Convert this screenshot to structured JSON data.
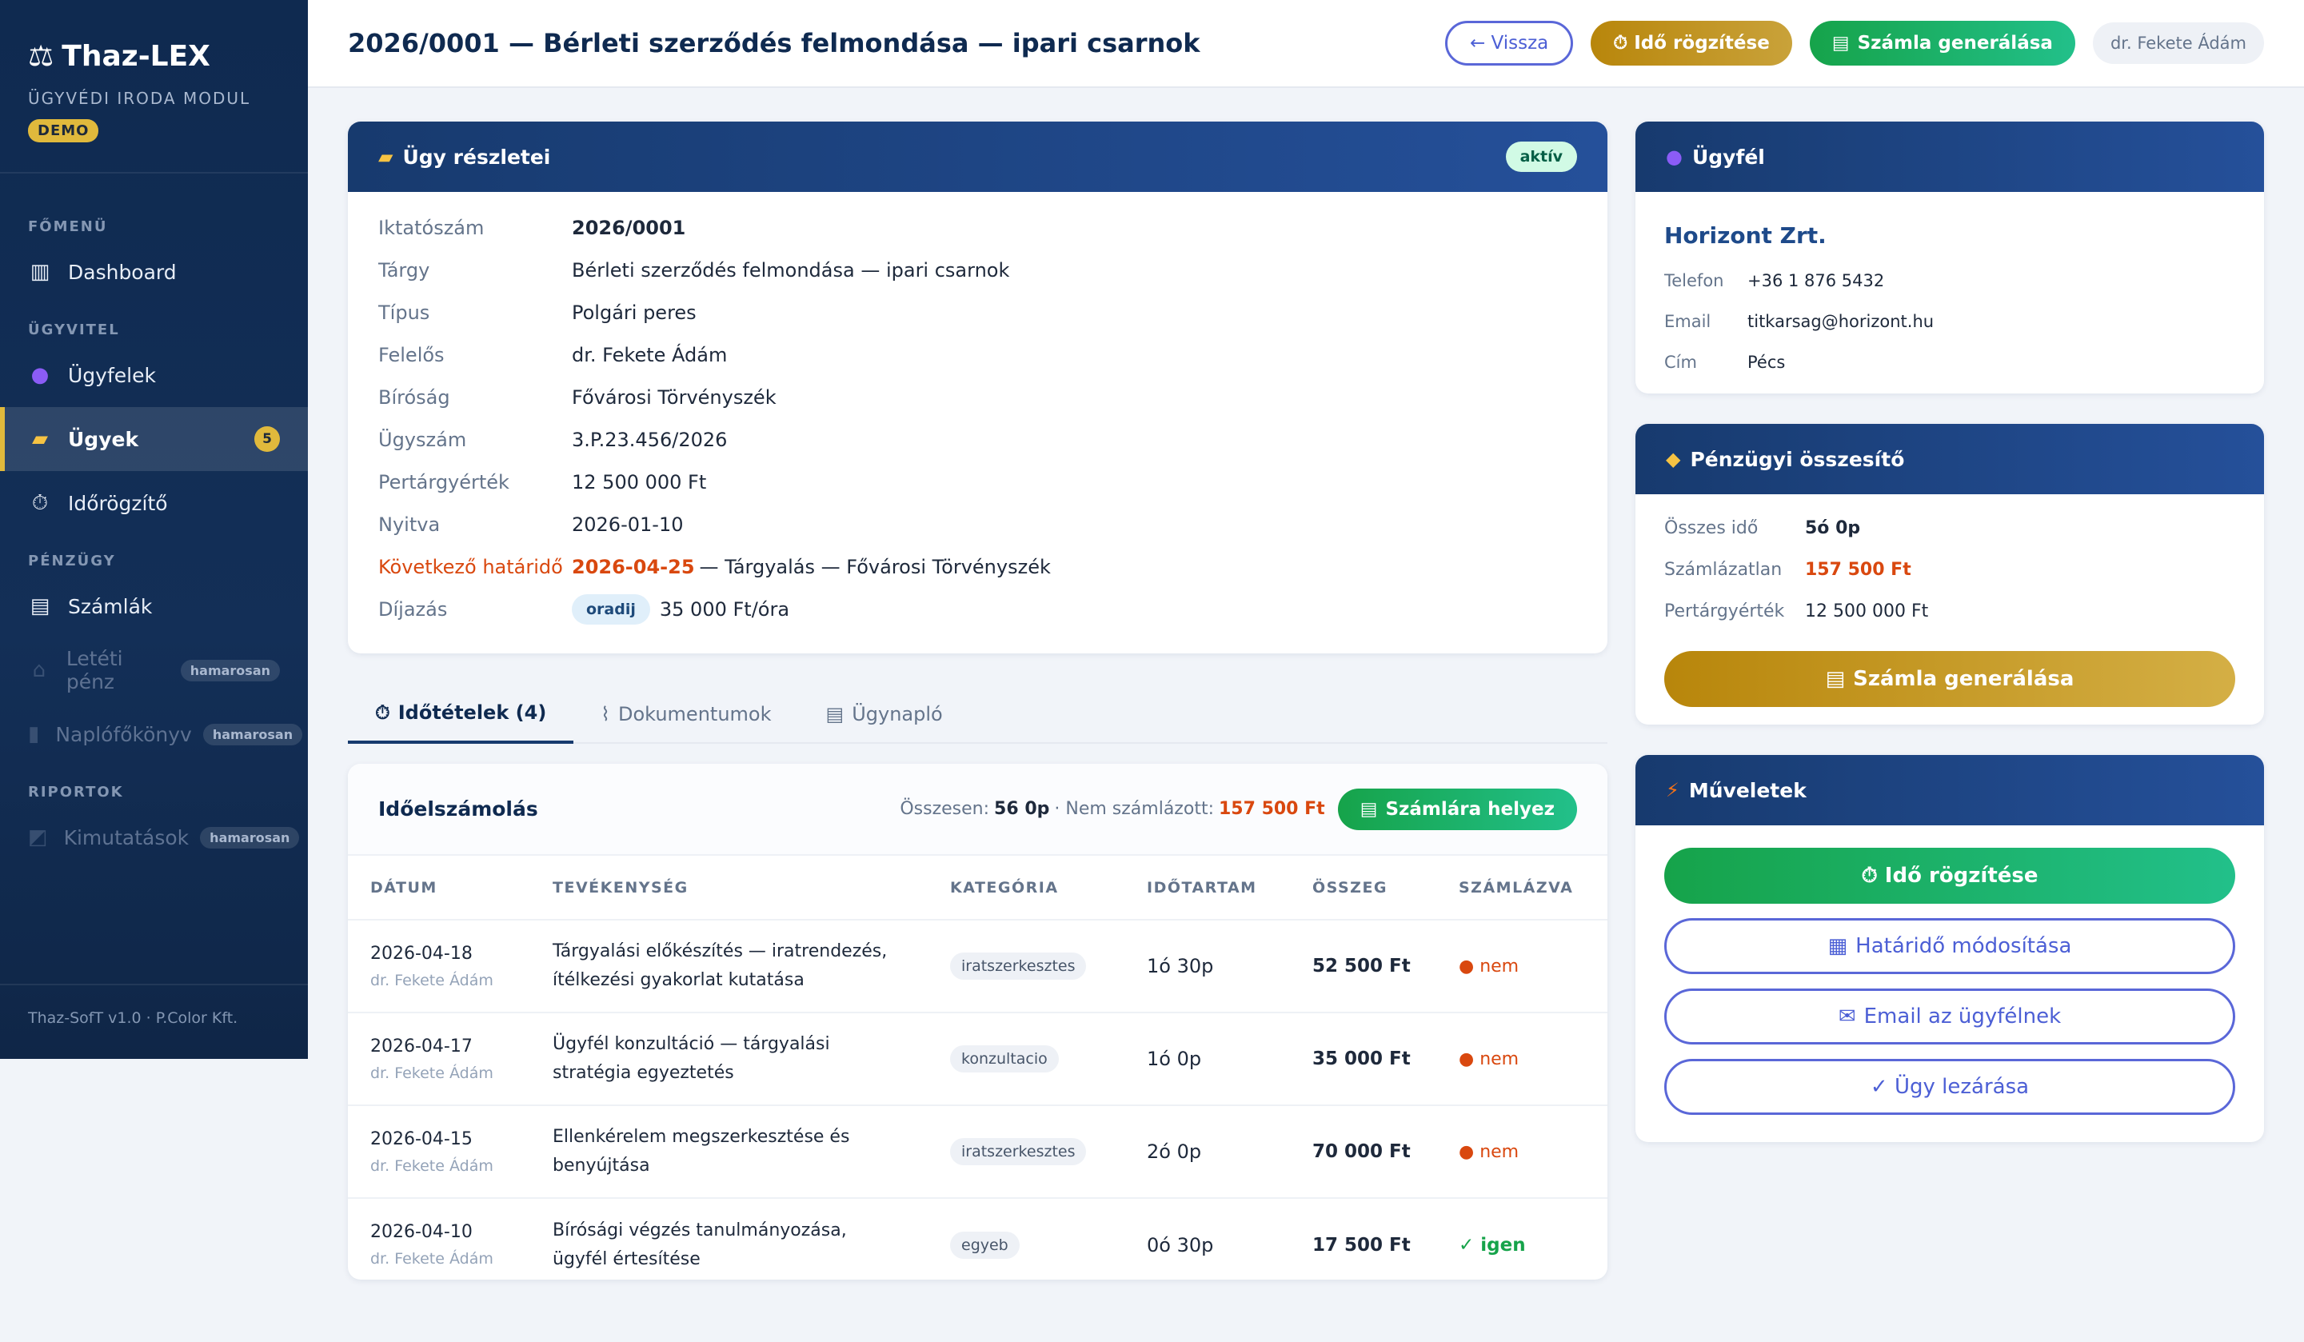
{
  "brand": {
    "name": "Thaz-LEX",
    "subtitle": "ÜGYVÉDI IRODA MODUL",
    "badge": "DEMO",
    "footer": "Thaz-SofT v1.0 · P.Color Kft."
  },
  "nav": {
    "section_main": "FŐMENÜ",
    "dashboard": "Dashboard",
    "section_case": "ÜGYVITEL",
    "clients": "Ügyfelek",
    "cases": "Ügyek",
    "cases_count": "5",
    "time": "Időrögzítő",
    "section_finance": "PÉNZÜGY",
    "invoices": "Számlák",
    "escrow": "Letéti pénz",
    "ledger": "Naplófőkönyv",
    "section_reports": "RIPORTOK",
    "stats": "Kimutatások",
    "soon": "hamarosan"
  },
  "header": {
    "title": "2026/0001 — Bérleti szerződés felmondása — ipari csarnok",
    "back": "← Vissza",
    "log_time": "⏱ Idő rögzítése",
    "gen_invoice": "Számla generálása",
    "user": "dr. Fekete Ádám"
  },
  "case": {
    "title": "Ügy részletei",
    "status": "aktív",
    "rows": [
      {
        "label": "Iktatószám",
        "value": "2026/0001"
      },
      {
        "label": "Tárgy",
        "value": "Bérleti szerződés felmondása — ipari csarnok"
      },
      {
        "label": "Típus",
        "value": "Polgári peres"
      },
      {
        "label": "Felelős",
        "value": "dr. Fekete Ádám"
      },
      {
        "label": "Bíróság",
        "value": "Fővárosi Törvényszék"
      },
      {
        "label": "Ügyszám",
        "value": "3.P.23.456/2026"
      },
      {
        "label": "Pertárgyérték",
        "value": "12 500 000 Ft"
      },
      {
        "label": "Nyitva",
        "value": "2026-01-10"
      }
    ],
    "deadline_label": "Következő határidő",
    "deadline_date": "2026-04-25",
    "deadline_text": "— Tárgyalás — Fővárosi Törvényszék",
    "fee_label": "Díjazás",
    "fee_type": "oradij",
    "fee_value": "35 000 Ft/óra"
  },
  "tabs": {
    "time": "Időtételek (4)",
    "docs": "Dokumentumok",
    "log": "Ügynapló"
  },
  "time_table": {
    "title": "Időelszámolás",
    "total_label": "Összesen:",
    "total_value": "56 0p",
    "unbilled_label": "· Nem számlázott:",
    "unbilled_value": "157 500 Ft",
    "bill_button": "Számlára helyez",
    "columns": [
      "DÁTUM",
      "TEVÉKENYSÉG",
      "KATEGÓRIA",
      "IDŐTARTAM",
      "ÖSSZEG",
      "SZÁMLÁZVA"
    ],
    "rows": [
      {
        "date": "2026-04-18",
        "who": "dr. Fekete Ádám",
        "activity": "Tárgyalási előkészítés — iratrendezés, ítélkezési gyakorlat kutatása",
        "category": "iratszerkesztes",
        "duration": "1ó 30p",
        "amount": "52 500 Ft",
        "billed": "● nem"
      },
      {
        "date": "2026-04-17",
        "who": "dr. Fekete Ádám",
        "activity": "Ügyfél konzultáció — tárgyalási stratégia egyeztetés",
        "category": "konzultacio",
        "duration": "1ó 0p",
        "amount": "35 000 Ft",
        "billed": "● nem"
      },
      {
        "date": "2026-04-15",
        "who": "dr. Fekete Ádám",
        "activity": "Ellenkérelem megszerkesztése és benyújtása",
        "category": "iratszerkesztes",
        "duration": "2ó 0p",
        "amount": "70 000 Ft",
        "billed": "● nem"
      },
      {
        "date": "2026-04-10",
        "who": "dr. Fekete Ádám",
        "activity": "Bírósági végzés tanulmányozása, ügyfél értesítése",
        "category": "egyeb",
        "duration": "0ó 30p",
        "amount": "17 500 Ft",
        "billed": "✓ igen"
      }
    ]
  },
  "client": {
    "title": "Ügyfél",
    "name": "Horizont Zrt.",
    "phone_label": "Telefon",
    "phone": "+36 1 876 5432",
    "email_label": "Email",
    "email": "titkarsag@horizont.hu",
    "address_label": "Cím",
    "address": "Pécs"
  },
  "finance": {
    "title": "Pénzügyi összesítő",
    "total_time_label": "Összes idő",
    "total_time": "5ó 0p",
    "unbilled_label": "Számlázatlan",
    "unbilled": "157 500 Ft",
    "value_label": "Pertárgyérték",
    "value": "12 500 000 Ft",
    "gen_button": "Számla generálása"
  },
  "actions": {
    "title": "Műveletek",
    "log_time": "⏱ Idő rögzítése",
    "deadline": "Határidő módosítása",
    "email": "Email az ügyfélnek",
    "close": "✓ Ügy lezárása"
  }
}
